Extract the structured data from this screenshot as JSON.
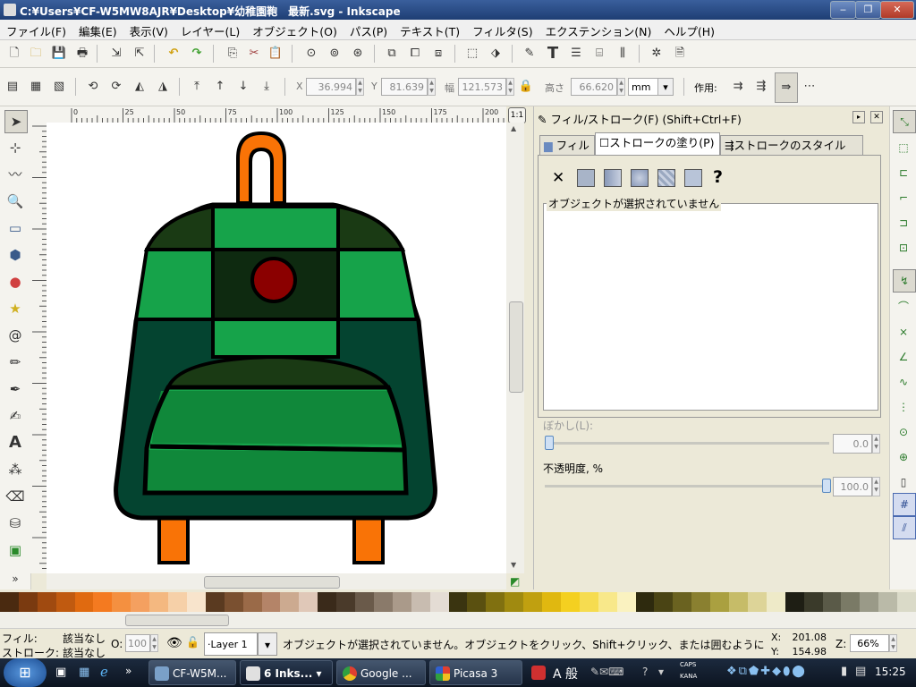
{
  "window": {
    "title": "C:¥Users¥CF-W5MW8AJR¥Desktop¥幼稚園鞄　最新.svg - Inkscape",
    "min_label": "‒",
    "max_label": "❐",
    "close_label": "✕"
  },
  "menu": [
    "ファイル(F)",
    "編集(E)",
    "表示(V)",
    "レイヤー(L)",
    "オブジェクト(O)",
    "パス(P)",
    "テキスト(T)",
    "フィルタ(S)",
    "エクステンション(N)",
    "ヘルプ(H)"
  ],
  "select_toolbar": {
    "x_label": "X",
    "x_value": "36.994",
    "y_label": "Y",
    "y_value": "81.639",
    "w_label": "幅",
    "w_value": "121.573",
    "h_label": "高さ",
    "h_value": "66.620",
    "unit": "mm",
    "affect_label": "作用:"
  },
  "ruler": {
    "top_ticks": [
      "0",
      "25",
      "50",
      "75",
      "100",
      "125",
      "150",
      "175",
      "200"
    ],
    "zoom_badge": "1:1"
  },
  "dock": {
    "title": "フィル/ストローク(F) (Shift+Ctrl+F)",
    "tabs": [
      "フィル",
      "ストロークの塗り(P)",
      "ストロークのスタイル(Y)"
    ],
    "paint_buttons": [
      "none",
      "flat",
      "linear",
      "radial",
      "pattern",
      "swatch",
      "unset"
    ],
    "unset_glyph": "?",
    "none_glyph": "✕",
    "fieldset_legend": "オブジェクトが選択されていません",
    "blur_label": "ぼかし(L):",
    "blur_value": "0.0",
    "blur_fraction": 0.0,
    "opacity_label": "不透明度, %",
    "opacity_value": "100.0",
    "opacity_fraction": 1.0
  },
  "status": {
    "fill_label": "フィル:",
    "fill_value": "該当なし",
    "stroke_label": "ストローク:",
    "stroke_value": "該当なし",
    "o_label": "O:",
    "o_value": "100",
    "layer": "·Layer 1",
    "message": "オブジェクトが選択されていません。オブジェクトをクリック、Shift+クリック、または囲むように",
    "x_label": "X:",
    "x_value": "201.08",
    "y_label": "Y:",
    "y_value": "154.98",
    "z_label": "Z:",
    "zoom": "66%"
  },
  "taskbar": {
    "tasks": [
      "CF-W5M...",
      "6 Inks...",
      "Google ...",
      "Picasa 3"
    ],
    "ime_text": "A 般",
    "caps": "CAPS",
    "kana": "KANA",
    "clock": "15:25"
  },
  "colors": {
    "bag_dark": "#044430",
    "bag_green": "#16a34a",
    "bag_darkest": "#0e2a10",
    "bag_top_dark": "#1a3a14",
    "handle_orange": "#f97306",
    "button_red": "#8b0000"
  },
  "palette": [
    "#4a2a10",
    "#7a3a10",
    "#a04a10",
    "#c05a10",
    "#e06a10",
    "#f47a20",
    "#f49040",
    "#f4a060",
    "#f4b880",
    "#f6d0a8",
    "#f8e4cc",
    "#5a3a20",
    "#7a5030",
    "#9a6a48",
    "#b48468",
    "#ccaa90",
    "#e0c8b8",
    "#3a2a1a",
    "#4a3a2a",
    "#6a5a4a",
    "#8a7a6a",
    "#aa9a8a",
    "#c8bcb0",
    "#e4dcd4",
    "#3a3410",
    "#5a5010",
    "#807010",
    "#a08a10",
    "#c0a010",
    "#e0b810",
    "#f4d020",
    "#f6dc50",
    "#f8e88a",
    "#faf2c0",
    "#2e2a0e",
    "#4a4414",
    "#6a6220",
    "#8a8030",
    "#aaa040",
    "#c6bc68",
    "#ddd498",
    "#eeeac8",
    "#1e1e14",
    "#3a3a2a",
    "#5a5a48",
    "#7a7a66",
    "#9a9a88",
    "#babaa8",
    "#dadac8"
  ]
}
